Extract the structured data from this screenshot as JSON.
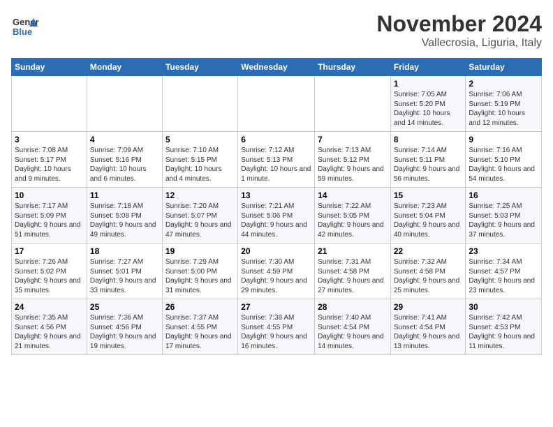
{
  "header": {
    "logo_text_general": "General",
    "logo_text_blue": "Blue",
    "month_year": "November 2024",
    "location": "Vallecrosia, Liguria, Italy"
  },
  "days_of_week": [
    "Sunday",
    "Monday",
    "Tuesday",
    "Wednesday",
    "Thursday",
    "Friday",
    "Saturday"
  ],
  "weeks": [
    [
      {
        "day": "",
        "detail": ""
      },
      {
        "day": "",
        "detail": ""
      },
      {
        "day": "",
        "detail": ""
      },
      {
        "day": "",
        "detail": ""
      },
      {
        "day": "",
        "detail": ""
      },
      {
        "day": "1",
        "detail": "Sunrise: 7:05 AM\nSunset: 5:20 PM\nDaylight: 10 hours and 14 minutes."
      },
      {
        "day": "2",
        "detail": "Sunrise: 7:06 AM\nSunset: 5:19 PM\nDaylight: 10 hours and 12 minutes."
      }
    ],
    [
      {
        "day": "3",
        "detail": "Sunrise: 7:08 AM\nSunset: 5:17 PM\nDaylight: 10 hours and 9 minutes."
      },
      {
        "day": "4",
        "detail": "Sunrise: 7:09 AM\nSunset: 5:16 PM\nDaylight: 10 hours and 6 minutes."
      },
      {
        "day": "5",
        "detail": "Sunrise: 7:10 AM\nSunset: 5:15 PM\nDaylight: 10 hours and 4 minutes."
      },
      {
        "day": "6",
        "detail": "Sunrise: 7:12 AM\nSunset: 5:13 PM\nDaylight: 10 hours and 1 minute."
      },
      {
        "day": "7",
        "detail": "Sunrise: 7:13 AM\nSunset: 5:12 PM\nDaylight: 9 hours and 59 minutes."
      },
      {
        "day": "8",
        "detail": "Sunrise: 7:14 AM\nSunset: 5:11 PM\nDaylight: 9 hours and 56 minutes."
      },
      {
        "day": "9",
        "detail": "Sunrise: 7:16 AM\nSunset: 5:10 PM\nDaylight: 9 hours and 54 minutes."
      }
    ],
    [
      {
        "day": "10",
        "detail": "Sunrise: 7:17 AM\nSunset: 5:09 PM\nDaylight: 9 hours and 51 minutes."
      },
      {
        "day": "11",
        "detail": "Sunrise: 7:18 AM\nSunset: 5:08 PM\nDaylight: 9 hours and 49 minutes."
      },
      {
        "day": "12",
        "detail": "Sunrise: 7:20 AM\nSunset: 5:07 PM\nDaylight: 9 hours and 47 minutes."
      },
      {
        "day": "13",
        "detail": "Sunrise: 7:21 AM\nSunset: 5:06 PM\nDaylight: 9 hours and 44 minutes."
      },
      {
        "day": "14",
        "detail": "Sunrise: 7:22 AM\nSunset: 5:05 PM\nDaylight: 9 hours and 42 minutes."
      },
      {
        "day": "15",
        "detail": "Sunrise: 7:23 AM\nSunset: 5:04 PM\nDaylight: 9 hours and 40 minutes."
      },
      {
        "day": "16",
        "detail": "Sunrise: 7:25 AM\nSunset: 5:03 PM\nDaylight: 9 hours and 37 minutes."
      }
    ],
    [
      {
        "day": "17",
        "detail": "Sunrise: 7:26 AM\nSunset: 5:02 PM\nDaylight: 9 hours and 35 minutes."
      },
      {
        "day": "18",
        "detail": "Sunrise: 7:27 AM\nSunset: 5:01 PM\nDaylight: 9 hours and 33 minutes."
      },
      {
        "day": "19",
        "detail": "Sunrise: 7:29 AM\nSunset: 5:00 PM\nDaylight: 9 hours and 31 minutes."
      },
      {
        "day": "20",
        "detail": "Sunrise: 7:30 AM\nSunset: 4:59 PM\nDaylight: 9 hours and 29 minutes."
      },
      {
        "day": "21",
        "detail": "Sunrise: 7:31 AM\nSunset: 4:58 PM\nDaylight: 9 hours and 27 minutes."
      },
      {
        "day": "22",
        "detail": "Sunrise: 7:32 AM\nSunset: 4:58 PM\nDaylight: 9 hours and 25 minutes."
      },
      {
        "day": "23",
        "detail": "Sunrise: 7:34 AM\nSunset: 4:57 PM\nDaylight: 9 hours and 23 minutes."
      }
    ],
    [
      {
        "day": "24",
        "detail": "Sunrise: 7:35 AM\nSunset: 4:56 PM\nDaylight: 9 hours and 21 minutes."
      },
      {
        "day": "25",
        "detail": "Sunrise: 7:36 AM\nSunset: 4:56 PM\nDaylight: 9 hours and 19 minutes."
      },
      {
        "day": "26",
        "detail": "Sunrise: 7:37 AM\nSunset: 4:55 PM\nDaylight: 9 hours and 17 minutes."
      },
      {
        "day": "27",
        "detail": "Sunrise: 7:38 AM\nSunset: 4:55 PM\nDaylight: 9 hours and 16 minutes."
      },
      {
        "day": "28",
        "detail": "Sunrise: 7:40 AM\nSunset: 4:54 PM\nDaylight: 9 hours and 14 minutes."
      },
      {
        "day": "29",
        "detail": "Sunrise: 7:41 AM\nSunset: 4:54 PM\nDaylight: 9 hours and 13 minutes."
      },
      {
        "day": "30",
        "detail": "Sunrise: 7:42 AM\nSunset: 4:53 PM\nDaylight: 9 hours and 11 minutes."
      }
    ]
  ]
}
